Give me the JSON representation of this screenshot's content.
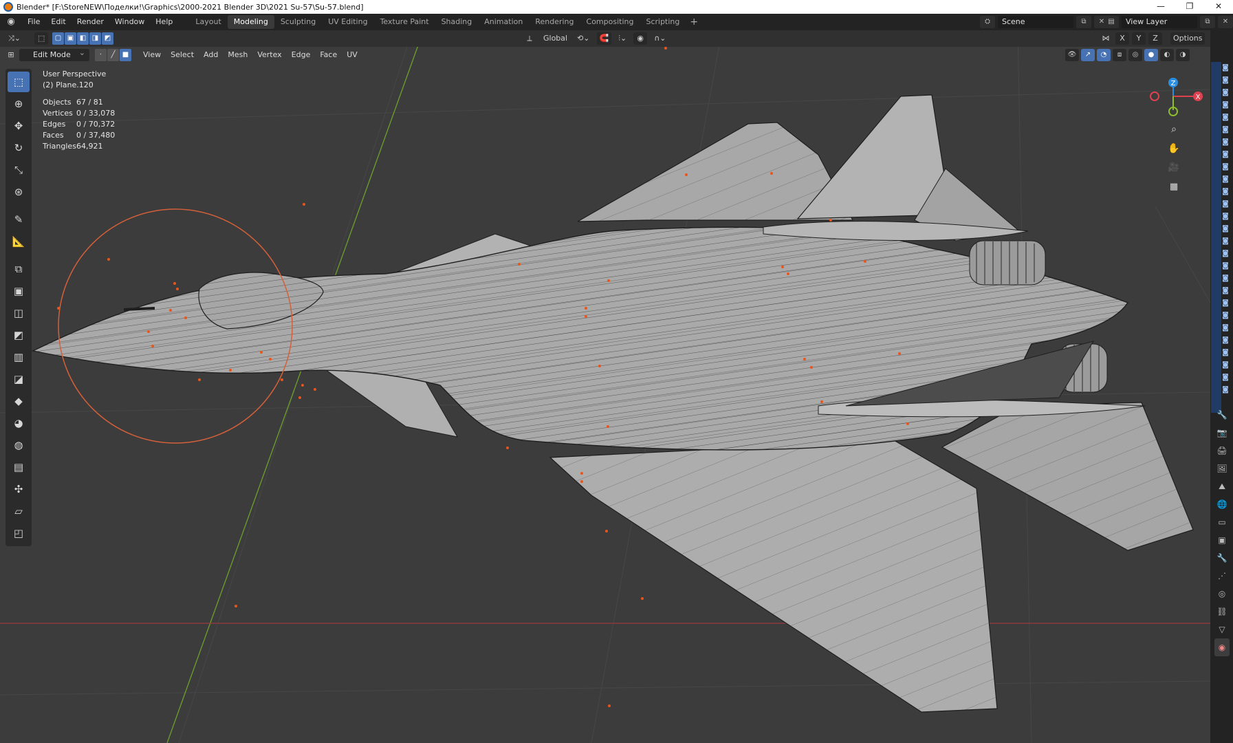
{
  "window": {
    "title": "Blender* [F:\\StoreNEW\\Поделки!\\Graphics\\2000-2021 Blender 3D\\2021 Su-57\\Su-57.blend]",
    "controls": [
      "—",
      "❐",
      "✕"
    ]
  },
  "menu": [
    "File",
    "Edit",
    "Render",
    "Window",
    "Help"
  ],
  "workspaces": [
    {
      "label": "Layout",
      "active": false
    },
    {
      "label": "Modeling",
      "active": true
    },
    {
      "label": "Sculpting",
      "active": false
    },
    {
      "label": "UV Editing",
      "active": false
    },
    {
      "label": "Texture Paint",
      "active": false
    },
    {
      "label": "Shading",
      "active": false
    },
    {
      "label": "Animation",
      "active": false
    },
    {
      "label": "Rendering",
      "active": false
    },
    {
      "label": "Compositing",
      "active": false
    },
    {
      "label": "Scripting",
      "active": false
    }
  ],
  "scene": {
    "label": "Scene"
  },
  "view_layer": {
    "label": "View Layer"
  },
  "tool_header": {
    "transform_orientation": "Global",
    "axes": [
      "X",
      "Y",
      "Z"
    ],
    "options_label": "Options"
  },
  "editor_header": {
    "mode": "Edit Mode",
    "menus": [
      "View",
      "Select",
      "Add",
      "Mesh",
      "Vertex",
      "Edge",
      "Face",
      "UV"
    ]
  },
  "overlay": {
    "perspective": "User Perspective",
    "object_name": "(2) Plane.120",
    "stats": [
      {
        "key": "Objects",
        "value": "67 / 81"
      },
      {
        "key": "Vertices",
        "value": "0 / 33,078"
      },
      {
        "key": "Edges",
        "value": "0 / 70,372"
      },
      {
        "key": "Faces",
        "value": "0 / 37,480"
      },
      {
        "key": "Triangles",
        "value": "64,921"
      }
    ]
  },
  "gizmo": {
    "axis_z": "Z",
    "axis_x": "X",
    "colors": {
      "x": "#e0414f",
      "y": "#8cbf2a",
      "z": "#2a8fe0"
    }
  },
  "tools": [
    {
      "icon": "select-box-icon",
      "glyph": "⬚",
      "active": true
    },
    {
      "icon": "cursor-icon",
      "glyph": "⊕",
      "active": false
    },
    {
      "icon": "move-icon",
      "glyph": "✥",
      "active": false
    },
    {
      "icon": "rotate-icon",
      "glyph": "↻",
      "active": false
    },
    {
      "icon": "scale-icon",
      "glyph": "⤡",
      "active": false
    },
    {
      "icon": "transform-icon",
      "glyph": "⊛",
      "active": false
    },
    {
      "icon": "annotate-icon",
      "glyph": "✎",
      "active": false
    },
    {
      "icon": "measure-icon",
      "glyph": "📐",
      "active": false
    },
    {
      "icon": "add-cube-icon",
      "glyph": "⧉",
      "active": false
    },
    {
      "icon": "extrude-icon",
      "glyph": "▣",
      "active": false
    },
    {
      "icon": "inset-icon",
      "glyph": "◫",
      "active": false
    },
    {
      "icon": "bevel-icon",
      "glyph": "◩",
      "active": false
    },
    {
      "icon": "loop-cut-icon",
      "glyph": "▥",
      "active": false
    },
    {
      "icon": "knife-icon",
      "glyph": "◪",
      "active": false
    },
    {
      "icon": "poly-build-icon",
      "glyph": "◆",
      "active": false
    },
    {
      "icon": "spin-icon",
      "glyph": "◕",
      "active": false
    },
    {
      "icon": "smooth-icon",
      "glyph": "◍",
      "active": false
    },
    {
      "icon": "edge-slide-icon",
      "glyph": "▤",
      "active": false
    },
    {
      "icon": "shrink-fatten-icon",
      "glyph": "✣",
      "active": false
    },
    {
      "icon": "shear-icon",
      "glyph": "▱",
      "active": false
    },
    {
      "icon": "rip-icon",
      "glyph": "◰",
      "active": false
    }
  ],
  "colors": {
    "accent": "#4772b3",
    "background": "#3c3c3c",
    "mesh": "#a9a9a9",
    "wire": "#1e1e1e",
    "vertex": "#e8561b"
  }
}
